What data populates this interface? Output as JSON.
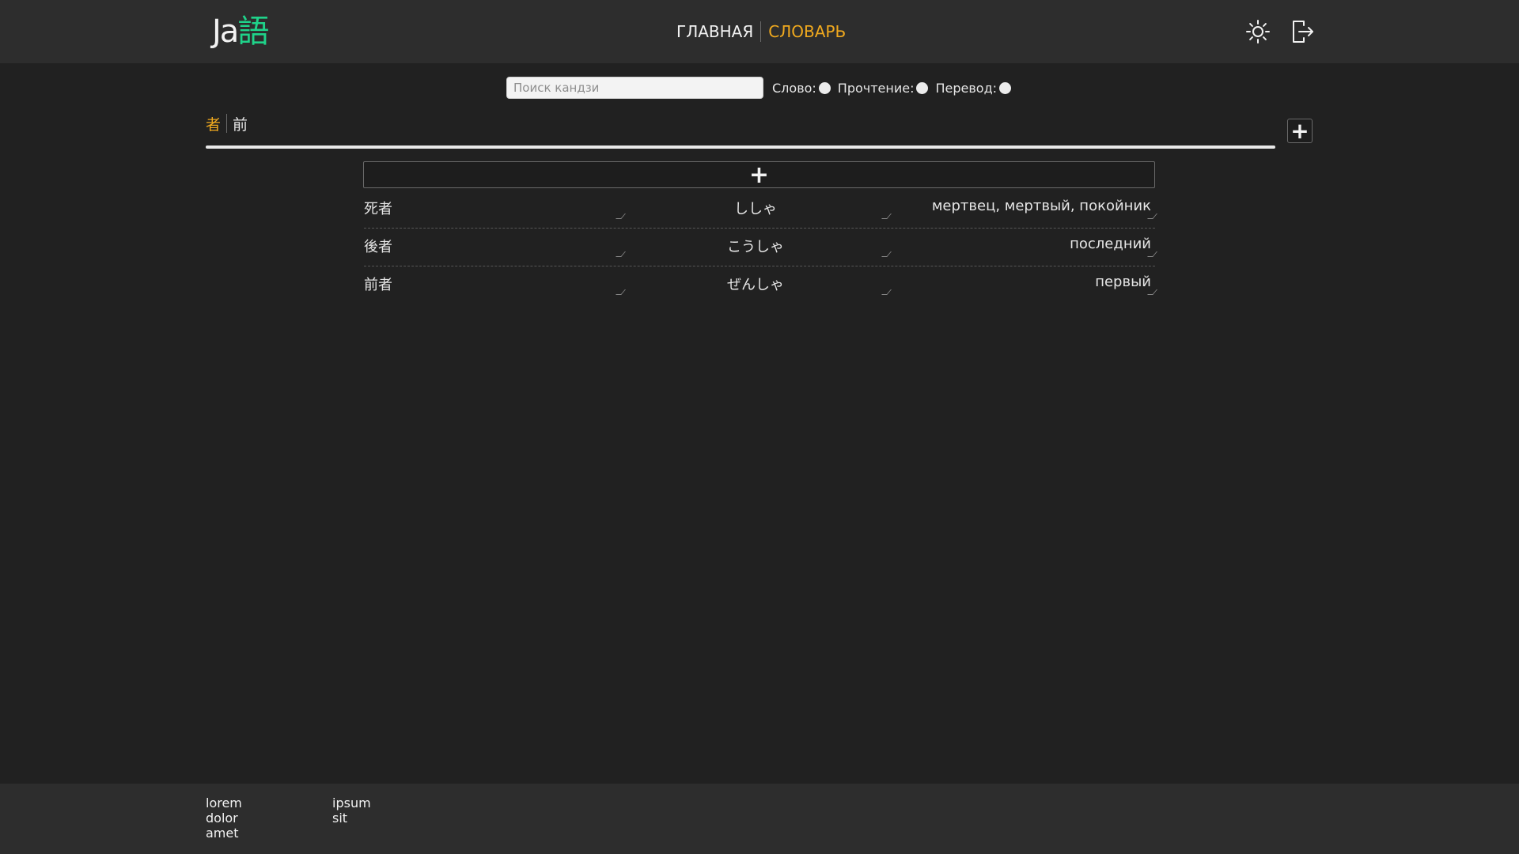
{
  "header": {
    "logo_latin": "Ja",
    "logo_kanji": "語",
    "nav": {
      "home": "ГЛАВНАЯ",
      "dictionary": "СЛОВАРЬ"
    },
    "icons": {
      "theme": "sun-icon",
      "logout": "logout-icon"
    },
    "colors": {
      "accent": "#f0a91e",
      "logo_kanji": "#1fd38a",
      "header_bg": "#2d2d2d",
      "page_bg": "#212121"
    }
  },
  "search": {
    "placeholder": "Поиск кандзи",
    "value": "",
    "filters": [
      {
        "label": "Слово:"
      },
      {
        "label": "Прочтение:"
      },
      {
        "label": "Перевод:"
      }
    ]
  },
  "kanji_tabs": {
    "items": [
      {
        "label": "者",
        "active": true
      },
      {
        "label": "前",
        "active": false
      }
    ],
    "add_icon": "plus-icon"
  },
  "words": {
    "add_icon": "plus-icon",
    "rows": [
      {
        "word": "死者",
        "reading": "ししゃ",
        "translation": "мертвец, мертвый, покойник"
      },
      {
        "word": "後者",
        "reading": "こうしゃ",
        "translation": "последний"
      },
      {
        "word": "前者",
        "reading": "ぜんしゃ",
        "translation": "первый"
      }
    ]
  },
  "footer": {
    "col1": [
      "lorem",
      "dolor",
      "amet"
    ],
    "col2": [
      "ipsum",
      "sit"
    ]
  }
}
